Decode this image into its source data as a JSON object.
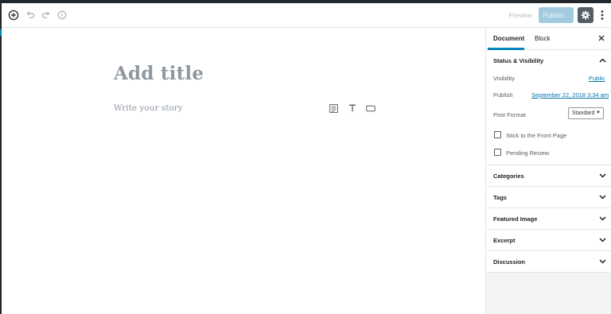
{
  "toolbar": {
    "preview_label": "Preview",
    "publish_label": "Publish..."
  },
  "editor": {
    "title_placeholder": "Add title",
    "body_placeholder": "Write your story"
  },
  "sidebar": {
    "tabs": [
      {
        "label": "Document",
        "active": true
      },
      {
        "label": "Block",
        "active": false
      }
    ],
    "status_visibility": {
      "title": "Status & Visibility",
      "visibility_label": "Visibility",
      "visibility_value": "Public",
      "publish_label": "Publish",
      "publish_value": "September 22, 2018 3:34 am",
      "post_format_label": "Post Format",
      "post_format_value": "Standard",
      "stick_label": "Stick to the Front Page",
      "pending_label": "Pending Review"
    },
    "panels": [
      {
        "title": "Categories"
      },
      {
        "title": "Tags"
      },
      {
        "title": "Featured Image"
      },
      {
        "title": "Excerpt"
      },
      {
        "title": "Discussion"
      }
    ]
  },
  "colors": {
    "accent": "#0085ba",
    "link": "#0073aa",
    "publish_button": "#a3cbe0",
    "settings_button": "#555d66"
  }
}
